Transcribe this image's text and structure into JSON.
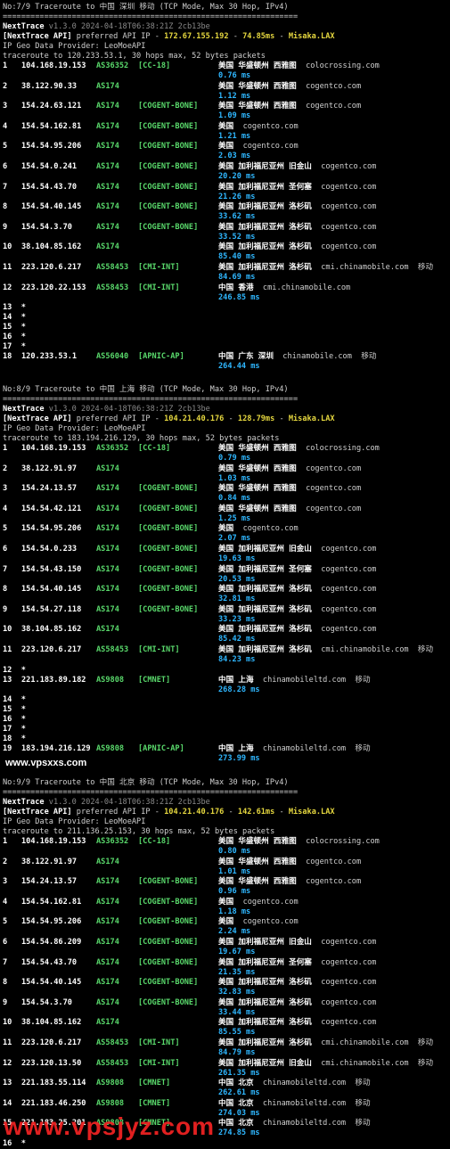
{
  "sections": [
    {
      "header": "No:7/9 Traceroute to 中国 深圳 移动 (TCP Mode, Max 30 Hop, IPv4)",
      "separator": "================================================================",
      "nt_name": "NextTrace",
      "nt_version": "v1.3.0 2024-04-18T06:38:21Z 2cb13be",
      "api_prefix": "[NextTrace API]",
      "api_mid": " preferred API IP - ",
      "api_ip": "172.67.155.192",
      "api_sep1": " - ",
      "api_ms": "74.85ms",
      "api_sep2": " - ",
      "api_node": "Misaka.LAX",
      "geo_provider": "IP Geo Data Provider: LeoMoeAPI",
      "traceroute_line": "traceroute to 120.233.53.1, 30 hops max, 52 bytes packets",
      "hops": [
        {
          "n": "1",
          "ip": "104.168.19.153",
          "as": "AS36352",
          "tag": "[CC-18]",
          "geo": "美国 华盛顿州 西雅图",
          "host": "colocrossing.com",
          "isp": "",
          "rtt": "0.76 ms"
        },
        {
          "n": "2",
          "ip": "38.122.90.33",
          "as": "AS174",
          "tag": "",
          "geo": "美国 华盛顿州 西雅图",
          "host": "cogentco.com",
          "isp": "",
          "rtt": "1.12 ms"
        },
        {
          "n": "3",
          "ip": "154.24.63.121",
          "as": "AS174",
          "tag": "[COGENT-BONE]",
          "geo": "美国 华盛顿州 西雅图",
          "host": "cogentco.com",
          "isp": "",
          "rtt": "1.09 ms"
        },
        {
          "n": "4",
          "ip": "154.54.162.81",
          "as": "AS174",
          "tag": "[COGENT-BONE]",
          "geo": "美国",
          "host": "cogentco.com",
          "isp": "",
          "rtt": "1.21 ms"
        },
        {
          "n": "5",
          "ip": "154.54.95.206",
          "as": "AS174",
          "tag": "[COGENT-BONE]",
          "geo": "美国",
          "host": "cogentco.com",
          "isp": "",
          "rtt": "2.03 ms"
        },
        {
          "n": "6",
          "ip": "154.54.0.241",
          "as": "AS174",
          "tag": "[COGENT-BONE]",
          "geo": "美国 加利福尼亚州 旧金山",
          "host": "cogentco.com",
          "isp": "",
          "rtt": "20.20 ms"
        },
        {
          "n": "7",
          "ip": "154.54.43.70",
          "as": "AS174",
          "tag": "[COGENT-BONE]",
          "geo": "美国 加利福尼亚州 圣何塞",
          "host": "cogentco.com",
          "isp": "",
          "rtt": "21.26 ms"
        },
        {
          "n": "8",
          "ip": "154.54.40.145",
          "as": "AS174",
          "tag": "[COGENT-BONE]",
          "geo": "美国 加利福尼亚州 洛杉矶",
          "host": "cogentco.com",
          "isp": "",
          "rtt": "33.62 ms"
        },
        {
          "n": "9",
          "ip": "154.54.3.70",
          "as": "AS174",
          "tag": "[COGENT-BONE]",
          "geo": "美国 加利福尼亚州 洛杉矶",
          "host": "cogentco.com",
          "isp": "",
          "rtt": "33.52 ms"
        },
        {
          "n": "10",
          "ip": "38.104.85.162",
          "as": "AS174",
          "tag": "",
          "geo": "美国 加利福尼亚州 洛杉矶",
          "host": "cogentco.com",
          "isp": "",
          "rtt": "85.40 ms"
        },
        {
          "n": "11",
          "ip": "223.120.6.217",
          "as": "AS58453",
          "tag": "[CMI-INT]",
          "geo": "美国 加利福尼亚州 洛杉矶",
          "host": "cmi.chinamobile.com",
          "isp": "移动",
          "rtt": "84.69 ms"
        },
        {
          "n": "12",
          "ip": "223.120.22.153",
          "as": "AS58453",
          "tag": "[CMI-INT]",
          "geo": "中国 香港",
          "host": "cmi.chinamobile.com",
          "isp": "",
          "rtt": "246.85 ms"
        }
      ],
      "stars": [
        "13  *",
        "14  *",
        "15  *",
        "16  *",
        "17  *"
      ],
      "last_hop": {
        "n": "18",
        "ip": "120.233.53.1",
        "as": "AS56040",
        "tag": "[APNIC-AP]",
        "geo": "中国 广东 深圳",
        "host": "chinamobile.com",
        "isp": "移动",
        "rtt": "264.44 ms"
      }
    },
    {
      "header": "No:8/9 Traceroute to 中国 上海 移动 (TCP Mode, Max 30 Hop, IPv4)",
      "separator": "================================================================",
      "nt_name": "NextTrace",
      "nt_version": "v1.3.0 2024-04-18T06:38:21Z 2cb13be",
      "api_prefix": "[NextTrace API]",
      "api_mid": " preferred API IP - ",
      "api_ip": "104.21.40.176",
      "api_sep1": " - ",
      "api_ms": "128.79ms",
      "api_sep2": " - ",
      "api_node": "Misaka.LAX",
      "geo_provider": "IP Geo Data Provider: LeoMoeAPI",
      "traceroute_line": "traceroute to 183.194.216.129, 30 hops max, 52 bytes packets",
      "hops": [
        {
          "n": "1",
          "ip": "104.168.19.153",
          "as": "AS36352",
          "tag": "[CC-18]",
          "geo": "美国 华盛顿州 西雅图",
          "host": "colocrossing.com",
          "isp": "",
          "rtt": "0.79 ms"
        },
        {
          "n": "2",
          "ip": "38.122.91.97",
          "as": "AS174",
          "tag": "",
          "geo": "美国 华盛顿州 西雅图",
          "host": "cogentco.com",
          "isp": "",
          "rtt": "1.03 ms"
        },
        {
          "n": "3",
          "ip": "154.24.13.57",
          "as": "AS174",
          "tag": "[COGENT-BONE]",
          "geo": "美国 华盛顿州 西雅图",
          "host": "cogentco.com",
          "isp": "",
          "rtt": "0.84 ms"
        },
        {
          "n": "4",
          "ip": "154.54.42.121",
          "as": "AS174",
          "tag": "[COGENT-BONE]",
          "geo": "美国 华盛顿州 西雅图",
          "host": "cogentco.com",
          "isp": "",
          "rtt": "1.25 ms"
        },
        {
          "n": "5",
          "ip": "154.54.95.206",
          "as": "AS174",
          "tag": "[COGENT-BONE]",
          "geo": "美国",
          "host": "cogentco.com",
          "isp": "",
          "rtt": "2.07 ms"
        },
        {
          "n": "6",
          "ip": "154.54.0.233",
          "as": "AS174",
          "tag": "[COGENT-BONE]",
          "geo": "美国 加利福尼亚州 旧金山",
          "host": "cogentco.com",
          "isp": "",
          "rtt": "19.63 ms"
        },
        {
          "n": "7",
          "ip": "154.54.43.150",
          "as": "AS174",
          "tag": "[COGENT-BONE]",
          "geo": "美国 加利福尼亚州 圣何塞",
          "host": "cogentco.com",
          "isp": "",
          "rtt": "20.53 ms"
        },
        {
          "n": "8",
          "ip": "154.54.40.145",
          "as": "AS174",
          "tag": "[COGENT-BONE]",
          "geo": "美国 加利福尼亚州 洛杉矶",
          "host": "cogentco.com",
          "isp": "",
          "rtt": "32.81 ms"
        },
        {
          "n": "9",
          "ip": "154.54.27.118",
          "as": "AS174",
          "tag": "[COGENT-BONE]",
          "geo": "美国 加利福尼亚州 洛杉矶",
          "host": "cogentco.com",
          "isp": "",
          "rtt": "33.23 ms"
        },
        {
          "n": "10",
          "ip": "38.104.85.162",
          "as": "AS174",
          "tag": "",
          "geo": "美国 加利福尼亚州 洛杉矶",
          "host": "cogentco.com",
          "isp": "",
          "rtt": "85.42 ms"
        },
        {
          "n": "11",
          "ip": "223.120.6.217",
          "as": "AS58453",
          "tag": "[CMI-INT]",
          "geo": "美国 加利福尼亚州 洛杉矶",
          "host": "cmi.chinamobile.com",
          "isp": "移动",
          "rtt": "84.23 ms"
        }
      ],
      "stars_a": [
        "12  *"
      ],
      "mid_hop": {
        "n": "13",
        "ip": "221.183.89.182",
        "as": "AS9808",
        "tag": "[CMNET]",
        "geo": "中国 上海",
        "host": "chinamobileltd.com",
        "isp": "移动",
        "rtt": "268.28 ms"
      },
      "stars": [
        "14  *",
        "15  *",
        "16  *",
        "17  *",
        "18  *"
      ],
      "last_hop": {
        "n": "19",
        "ip": "183.194.216.129",
        "as": "AS9808",
        "tag": "[APNIC-AP]",
        "geo": "中国 上海",
        "host": "chinamobileltd.com",
        "isp": "移动",
        "rtt": "273.99 ms"
      }
    },
    {
      "header": "No:9/9 Traceroute to 中国 北京 移动 (TCP Mode, Max 30 Hop, IPv4)",
      "separator": "================================================================",
      "nt_name": "NextTrace",
      "nt_version": "v1.3.0 2024-04-18T06:38:21Z 2cb13be",
      "api_prefix": "[NextTrace API]",
      "api_mid": " preferred API IP - ",
      "api_ip": "104.21.40.176",
      "api_sep1": " - ",
      "api_ms": "142.61ms",
      "api_sep2": " - ",
      "api_node": "Misaka.LAX",
      "geo_provider": "IP Geo Data Provider: LeoMoeAPI",
      "traceroute_line": "traceroute to 211.136.25.153, 30 hops max, 52 bytes packets",
      "hops": [
        {
          "n": "1",
          "ip": "104.168.19.153",
          "as": "AS36352",
          "tag": "[CC-18]",
          "geo": "美国 华盛顿州 西雅图",
          "host": "colocrossing.com",
          "isp": "",
          "rtt": "0.80 ms"
        },
        {
          "n": "2",
          "ip": "38.122.91.97",
          "as": "AS174",
          "tag": "",
          "geo": "美国 华盛顿州 西雅图",
          "host": "cogentco.com",
          "isp": "",
          "rtt": "1.01 ms"
        },
        {
          "n": "3",
          "ip": "154.24.13.57",
          "as": "AS174",
          "tag": "[COGENT-BONE]",
          "geo": "美国 华盛顿州 西雅图",
          "host": "cogentco.com",
          "isp": "",
          "rtt": "0.96 ms"
        },
        {
          "n": "4",
          "ip": "154.54.162.81",
          "as": "AS174",
          "tag": "[COGENT-BONE]",
          "geo": "美国",
          "host": "cogentco.com",
          "isp": "",
          "rtt": "1.18 ms"
        },
        {
          "n": "5",
          "ip": "154.54.95.206",
          "as": "AS174",
          "tag": "[COGENT-BONE]",
          "geo": "美国",
          "host": "cogentco.com",
          "isp": "",
          "rtt": "2.24 ms"
        },
        {
          "n": "6",
          "ip": "154.54.86.209",
          "as": "AS174",
          "tag": "[COGENT-BONE]",
          "geo": "美国 加利福尼亚州 旧金山",
          "host": "cogentco.com",
          "isp": "",
          "rtt": "19.67 ms"
        },
        {
          "n": "7",
          "ip": "154.54.43.70",
          "as": "AS174",
          "tag": "[COGENT-BONE]",
          "geo": "美国 加利福尼亚州 圣何塞",
          "host": "cogentco.com",
          "isp": "",
          "rtt": "21.35 ms"
        },
        {
          "n": "8",
          "ip": "154.54.40.145",
          "as": "AS174",
          "tag": "[COGENT-BONE]",
          "geo": "美国 加利福尼亚州 洛杉矶",
          "host": "cogentco.com",
          "isp": "",
          "rtt": "32.83 ms"
        },
        {
          "n": "9",
          "ip": "154.54.3.70",
          "as": "AS174",
          "tag": "[COGENT-BONE]",
          "geo": "美国 加利福尼亚州 洛杉矶",
          "host": "cogentco.com",
          "isp": "",
          "rtt": "33.44 ms"
        },
        {
          "n": "10",
          "ip": "38.104.85.162",
          "as": "AS174",
          "tag": "",
          "geo": "美国 加利福尼亚州 洛杉矶",
          "host": "cogentco.com",
          "isp": "",
          "rtt": "85.55 ms"
        },
        {
          "n": "11",
          "ip": "223.120.6.217",
          "as": "AS58453",
          "tag": "[CMI-INT]",
          "geo": "美国 加利福尼亚州 洛杉矶",
          "host": "cmi.chinamobile.com",
          "isp": "移动",
          "rtt": "84.79 ms"
        },
        {
          "n": "12",
          "ip": "223.120.13.50",
          "as": "AS58453",
          "tag": "[CMI-INT]",
          "geo": "美国 加利福尼亚州 旧金山",
          "host": "cmi.chinamobile.com",
          "isp": "移动",
          "rtt": "261.35 ms"
        },
        {
          "n": "13",
          "ip": "221.183.55.114",
          "as": "AS9808",
          "tag": "[CMNET]",
          "geo": "中国 北京",
          "host": "chinamobileltd.com",
          "isp": "移动",
          "rtt": "262.61 ms"
        },
        {
          "n": "14",
          "ip": "221.183.46.250",
          "as": "AS9808",
          "tag": "[CMNET]",
          "geo": "中国 北京",
          "host": "chinamobileltd.com",
          "isp": "移动",
          "rtt": "274.03 ms"
        },
        {
          "n": "15",
          "ip": "221.183.25.201",
          "as": "AS9808",
          "tag": "[CMNET]",
          "geo": "中国 北京",
          "host": "chinamobileltd.com",
          "isp": "移动",
          "rtt": "274.85 ms"
        }
      ],
      "stars": [
        "16  *"
      ]
    }
  ],
  "watermark_small": "www.vpsxxs.com",
  "watermark_big": "www.vpsjyz.com",
  "colors": {
    "background": "#000000",
    "as_green": "#59d86b",
    "rtt_blue": "#2fb7ff",
    "api_yellow": "#e5d73f",
    "watermark_red": "#e22222"
  }
}
